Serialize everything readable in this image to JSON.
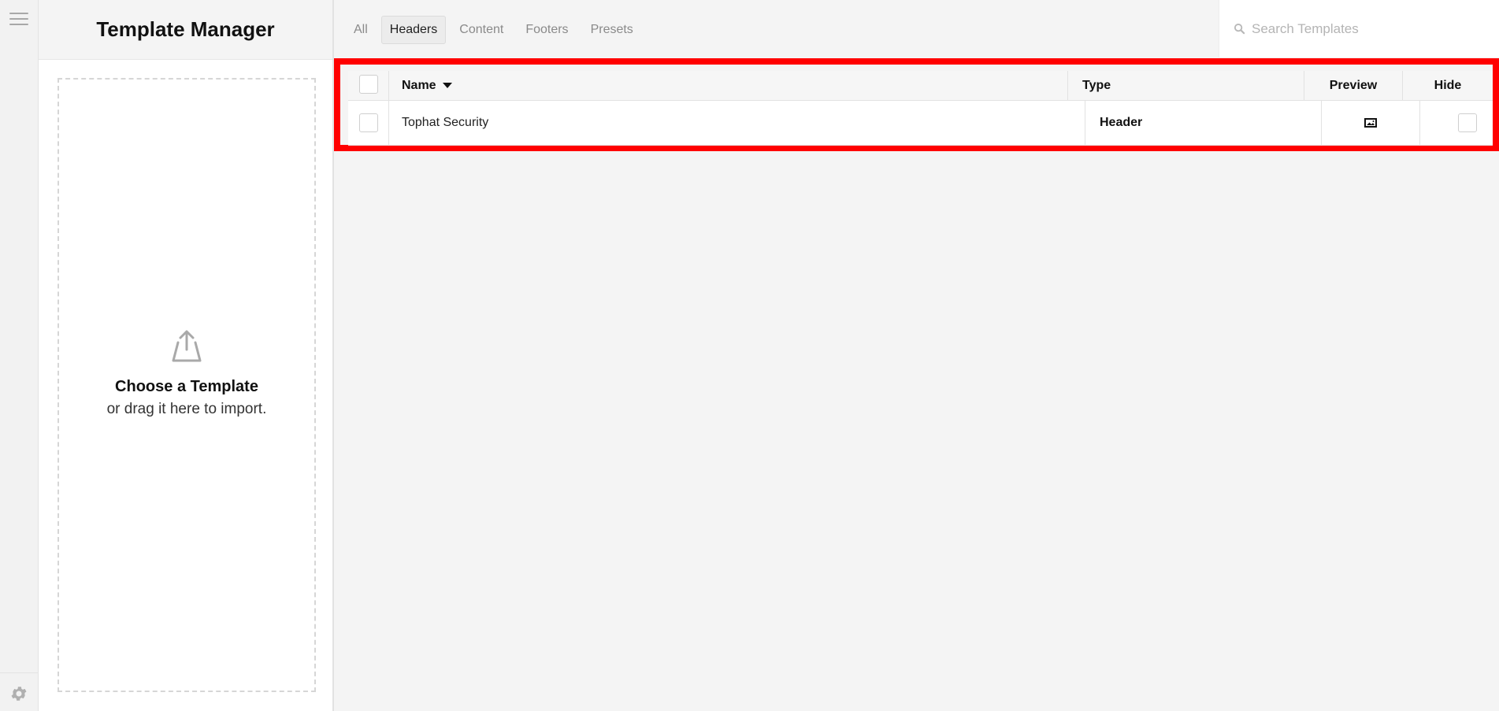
{
  "sidebar": {
    "menu_icon": "hamburger-icon",
    "settings_icon": "gear-icon"
  },
  "panel": {
    "title": "Template Manager",
    "dropzone": {
      "icon": "upload-icon",
      "title": "Choose a Template",
      "subtitle": "or drag it here to import."
    }
  },
  "tabs": [
    {
      "label": "All",
      "active": false
    },
    {
      "label": "Headers",
      "active": true
    },
    {
      "label": "Content",
      "active": false
    },
    {
      "label": "Footers",
      "active": false
    },
    {
      "label": "Presets",
      "active": false
    }
  ],
  "search": {
    "placeholder": "Search Templates",
    "value": ""
  },
  "table": {
    "columns": [
      "Name",
      "Type",
      "Preview",
      "Hide"
    ],
    "sort_column": "Name",
    "sort_direction": "desc",
    "rows": [
      {
        "name": "Tophat Security",
        "type": "Header",
        "preview_icon": "image-icon",
        "hidden": false
      }
    ]
  },
  "colors": {
    "highlight": "#ff0000",
    "background": "#f4f4f4"
  }
}
